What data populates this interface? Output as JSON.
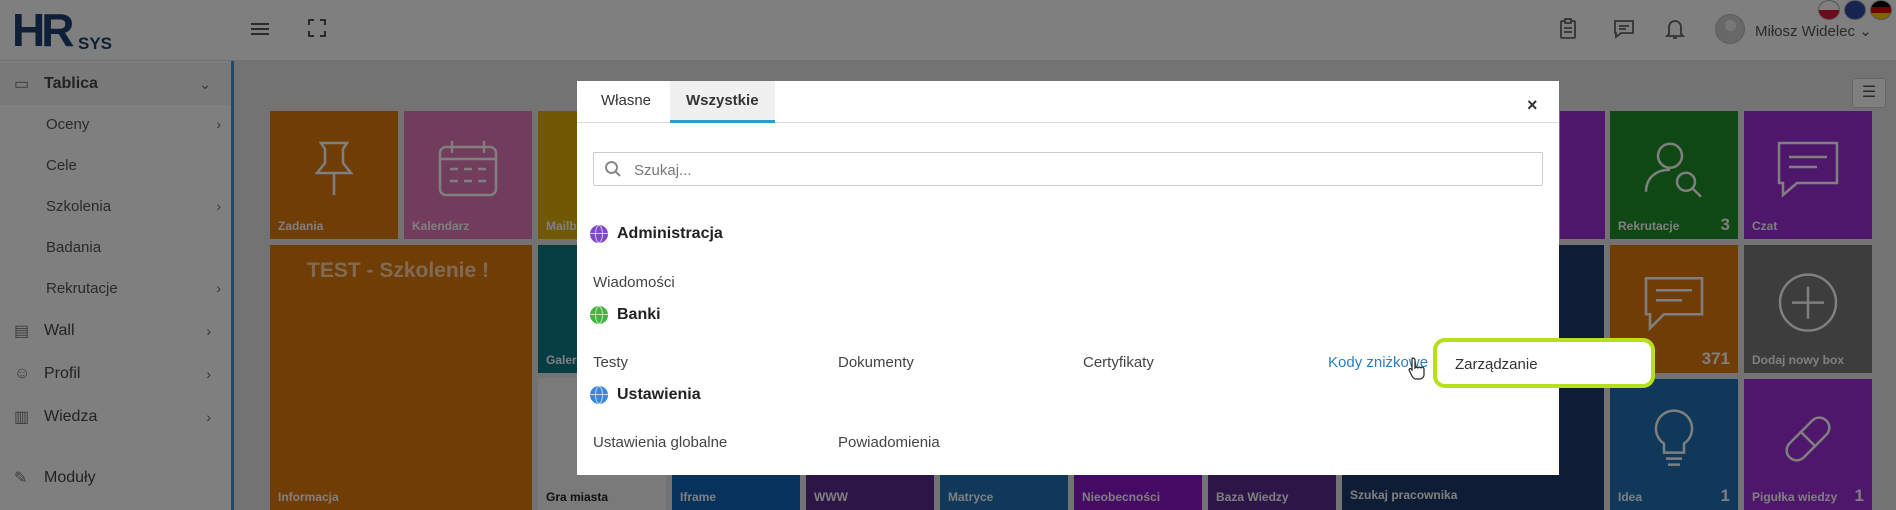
{
  "header": {
    "logo_hr": "HR",
    "logo_sys": "SYS",
    "user_name": "Miłosz Widelec",
    "user_chevron": "⌄",
    "icons": [
      "menu-icon",
      "fullscreen-icon",
      "clipboard-icon",
      "chat-icon",
      "bell-icon"
    ]
  },
  "sidebar": {
    "items": [
      {
        "label": "Tablica",
        "icon": "monitor-icon",
        "chev": "⌄"
      },
      {
        "label": "Wall",
        "icon": "wall-icon",
        "chev": "›"
      },
      {
        "label": "Profil",
        "icon": "user-icon",
        "chev": "›"
      },
      {
        "label": "Wiedza",
        "icon": "book-icon",
        "chev": "›"
      },
      {
        "label": "Moduły",
        "icon": "wrench-icon"
      }
    ],
    "subitems": [
      {
        "label": "Oceny",
        "chev": "›"
      },
      {
        "label": "Cele"
      },
      {
        "label": "Szkolenia",
        "chev": "›"
      },
      {
        "label": "Badania"
      },
      {
        "label": "Rekrutacje",
        "chev": "›"
      }
    ]
  },
  "tiles": {
    "zadania": "Zadania",
    "kalendarz": "Kalendarz",
    "mailb": "Mailb",
    "rekrutacje": "Rekrutacje",
    "rekrutacje_count": "3",
    "czat": "Czat",
    "test_title": "TEST - Szkolenie !",
    "informacja": "Informacja",
    "galeria": "Galer",
    "gra_miasta": "Gra miasta",
    "iframe": "Iframe",
    "www": "WWW",
    "matryce": "Matryce",
    "nieobecnosci": "Nieobecności",
    "baza_wiedzy": "Baza Wiedzy",
    "szukaj_pracownika": "Szukaj pracownika",
    "komentarze_count": "371",
    "dodaj_box": "Dodaj nowy box",
    "idea": "Idea",
    "idea_count": "1",
    "pigulka": "Pigułka wiedzy",
    "pigulka_count": "1",
    "colors": {
      "orange": "#e07a0c",
      "pink": "#e57ab9",
      "yellow": "#e2b10b",
      "green": "#1f8f2b",
      "purple": "#9c2ed8",
      "teal": "#0a7a86",
      "blue": "#0f64b8",
      "darkpurple": "#5a2b90",
      "mid": "#1f70b6",
      "mag": "#8b16c9",
      "navy": "#1c3a6a",
      "gray": "#7a7a7a"
    }
  },
  "modal": {
    "tabs": [
      "Własne",
      "Wszystkie"
    ],
    "close": "×",
    "search_placeholder": "Szukaj...",
    "sections": [
      {
        "title": "Administracja",
        "color": "#7d48c9",
        "items": [
          "Wiadomości"
        ]
      },
      {
        "title": "Banki",
        "color": "#3fb53f",
        "items": [
          "Testy",
          "Dokumenty",
          "Certyfikaty",
          "Kody zniżkowe"
        ]
      },
      {
        "title": "Ustawienia",
        "color": "#3a86d8",
        "items": [
          "Ustawienia globalne",
          "Powiadomienia"
        ]
      }
    ],
    "submenu": "Zarządzanie"
  }
}
